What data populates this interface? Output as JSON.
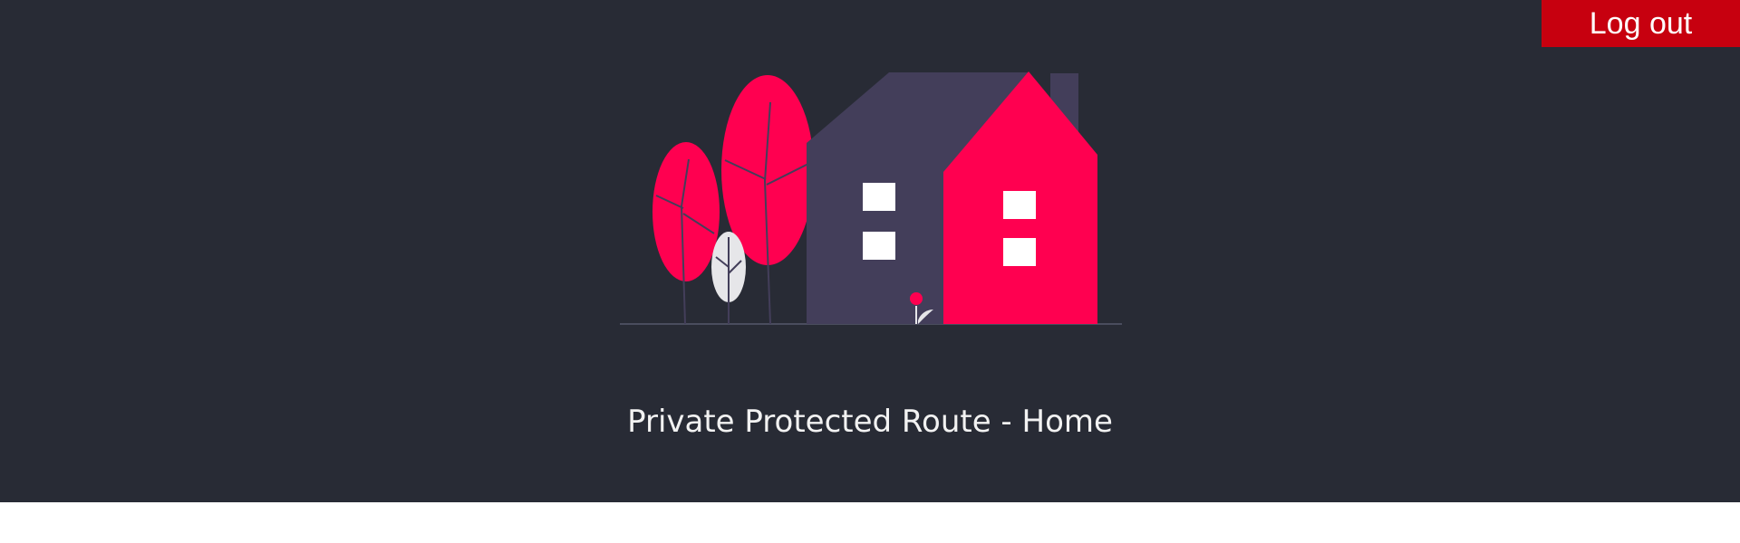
{
  "header": {
    "logout_label": "Log out"
  },
  "main": {
    "title": "Private Protected Route - Home",
    "illustration": "house-with-trees"
  },
  "colors": {
    "background": "#282b35",
    "accent": "#ff0050",
    "house_dark": "#433e5a",
    "logout_bg": "#c7000f"
  }
}
